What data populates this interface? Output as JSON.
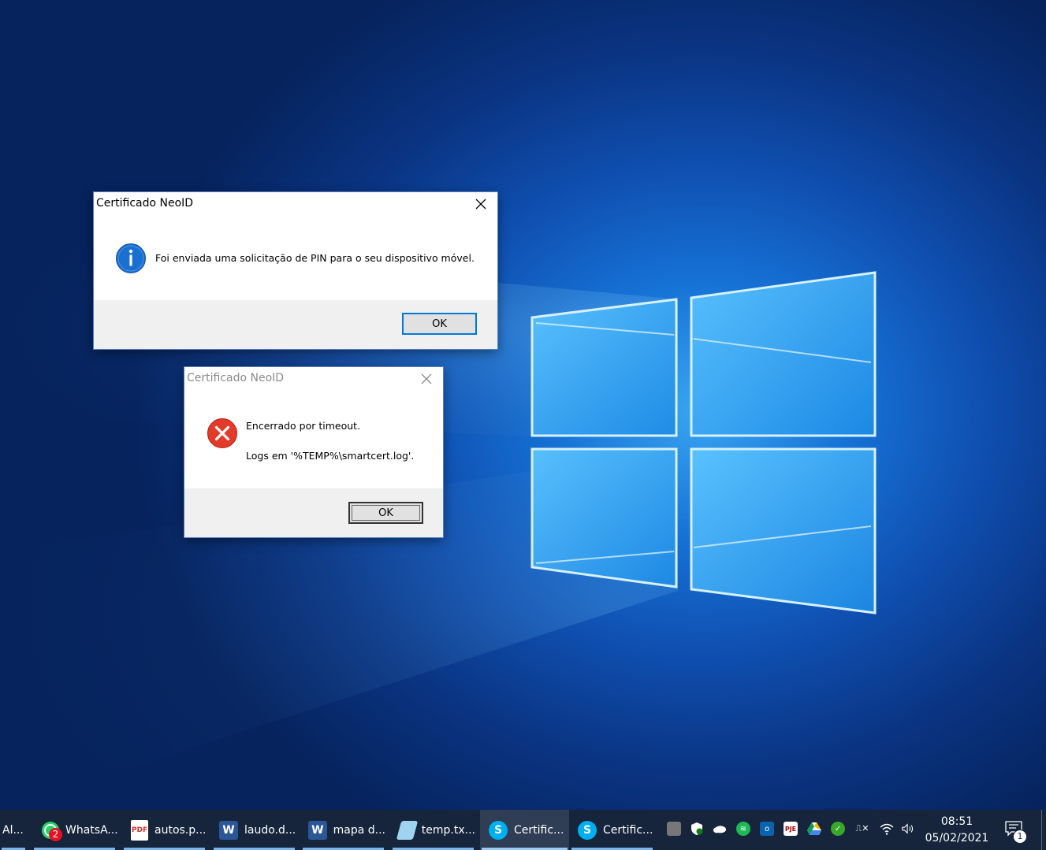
{
  "dialogs": [
    {
      "title": "Certificado NeoID",
      "message": "Foi enviada uma solicitação de PIN para o seu dispositivo móvel.",
      "ok_label": "OK",
      "icon": "info-icon",
      "active": true
    },
    {
      "title": "Certificado NeoID",
      "message_line1": "Encerrado por timeout.",
      "message_line2": "Logs em '%TEMP%\\smartcert.log'.",
      "ok_label": "OK",
      "icon": "error-icon",
      "active": false
    }
  ],
  "taskbar": {
    "items": [
      {
        "label": "Al...",
        "icon": "generic-app-icon"
      },
      {
        "label": "WhatsA...",
        "icon": "whatsapp-icon",
        "badge": "2"
      },
      {
        "label": "autos.p...",
        "icon": "pdf-icon"
      },
      {
        "label": "laudo.d...",
        "icon": "word-icon"
      },
      {
        "label": "mapa d...",
        "icon": "word-icon"
      },
      {
        "label": "temp.tx...",
        "icon": "notepad-icon"
      },
      {
        "label": "Certific...",
        "icon": "skype-icon",
        "active": true
      },
      {
        "label": "Certific...",
        "icon": "skype-icon"
      }
    ],
    "tray": {
      "time": "08:51",
      "date": "05/02/2021",
      "notification_count": "1"
    }
  },
  "colors": {
    "accent": "#0078d7",
    "taskbar": "#16243c",
    "error": "#e81123"
  }
}
